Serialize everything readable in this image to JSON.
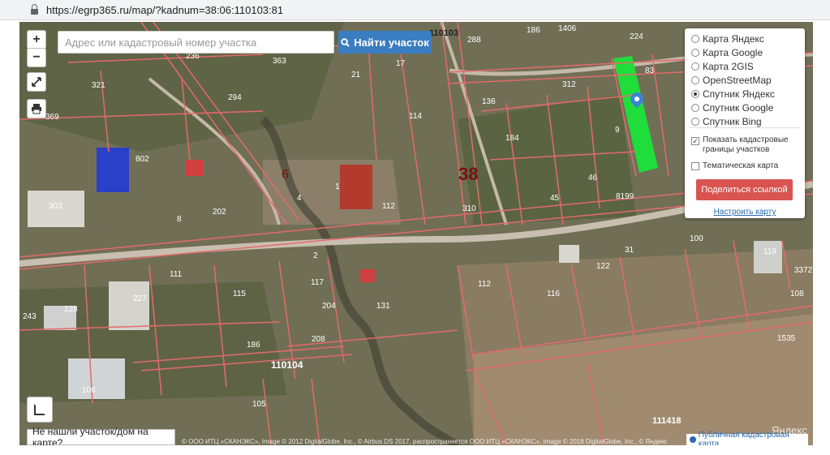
{
  "browser": {
    "url": "https://egrp365.ru/map/?kadnum=38:06:110103:81"
  },
  "map": {
    "zoom_in": "+",
    "zoom_out": "−",
    "search_placeholder": "Адрес или кадастровый номер участка",
    "search_button": "Найти участок",
    "layer_options": [
      {
        "label": "Карта Яндекс",
        "selected": false
      },
      {
        "label": "Карта Google",
        "selected": false
      },
      {
        "label": "Карта 2GIS",
        "selected": false
      },
      {
        "label": "OpenStreetMap",
        "selected": false
      },
      {
        "label": "Спутник Яндекс",
        "selected": true
      },
      {
        "label": "Спутник Google",
        "selected": false
      },
      {
        "label": "Спутник Bing",
        "selected": false
      }
    ],
    "show_boundaries_label": "Показать кадастровые границы участков",
    "show_boundaries_checked": true,
    "thematic_label": "Тематическая карта",
    "thematic_checked": false,
    "share_button": "Поделиться ссылкой",
    "configure_link": "Настроить карту",
    "not_found_button": "Не нашли участок/дом на карте?",
    "public_map_link": "Публичная кадастровая карта",
    "watermark": "Яндекс",
    "copyright": "© ООО ИТЦ «СКАНЭКС», Image © 2012 DigitalGlobe, Inc., © Airbus DS 2017, распространяется ООО ИТЦ «СКАНЭКС», Image © 2018 DigitalGlobe, Inc., © Яндекс",
    "highlight_color": "#1fdd3a",
    "boundary_color": "#e56a6a",
    "labels": {
      "block_38": "38",
      "block_6": "6",
      "quarter_110103": "110103",
      "quarter_110104": "110104",
      "quarter_111418": "111418",
      "road_8199": "8199",
      "p1": "236",
      "p2": "363",
      "p3": "321",
      "p4": "294",
      "p5": "369",
      "p6": "802",
      "p7": "303",
      "p8": "202",
      "p9": "112",
      "p10": "310",
      "p11": "184",
      "p12": "114",
      "p13": "136",
      "p14": "312",
      "p15": "83",
      "p16": "1406",
      "p17": "224",
      "p18": "288",
      "p19": "186",
      "p20": "46",
      "p21": "45",
      "p22": "122",
      "p23": "31",
      "p24": "119",
      "p25": "3372",
      "p26": "1535",
      "p27": "116",
      "p28": "112",
      "p29": "131",
      "p30": "204",
      "p31": "117",
      "p32": "115",
      "p33": "128",
      "p34": "227",
      "p35": "186",
      "p36": "106",
      "p37": "105",
      "p38": "100",
      "p39": "243",
      "p40": "17",
      "p41": "21",
      "p42": "8",
      "p43": "4",
      "p44": "1",
      "p45": "2",
      "p46": "9",
      "p47": "111",
      "p48": "208",
      "p49": "108"
    }
  }
}
